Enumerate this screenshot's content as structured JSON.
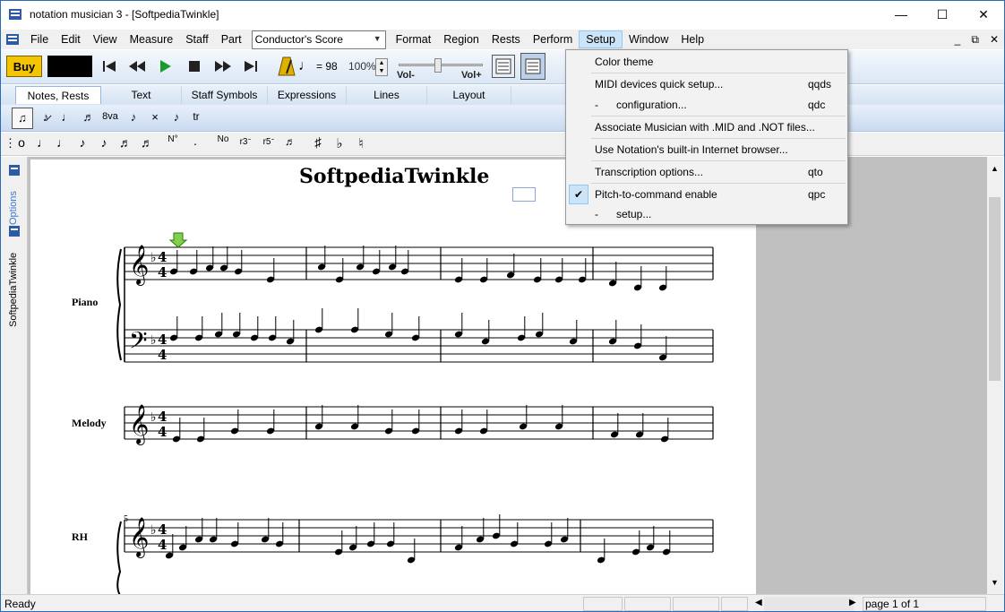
{
  "window": {
    "title": "notation musician 3 - [SoftpediaTwinkle]",
    "minimize": "—",
    "maximize": "☐",
    "close": "✕"
  },
  "menubar": {
    "items": [
      "File",
      "Edit",
      "View",
      "Measure",
      "Staff",
      "Part"
    ],
    "part_combo": "Conductor's Score",
    "items2": [
      "Format",
      "Region",
      "Rests",
      "Perform",
      "Setup",
      "Window",
      "Help"
    ],
    "mdi": {
      "minimize": "_",
      "restore": "⧉",
      "close": "✕"
    }
  },
  "toolbar": {
    "buy_label": "Buy",
    "tempo": "= 98",
    "zoom": "100%",
    "vol_minus": "Vol-",
    "vol_plus": "Vol+"
  },
  "palette_tabs": [
    "Notes, Rests",
    "Text",
    "Staff Symbols",
    "Expressions",
    "Lines",
    "Layout"
  ],
  "palette1_glyphs": [
    "♫",
    "♪̷",
    "♩",
    "♬",
    "8va",
    "♪",
    "×",
    "♪",
    "tr"
  ],
  "palette2_glyphs": [
    "·",
    "𝅝",
    "𝅗𝅥",
    "♩",
    "♪",
    "♬",
    "♬",
    "♬",
    "N",
    "·",
    "N",
    "r3",
    "r5",
    "r6",
    "♯",
    "♭",
    "♮"
  ],
  "sidebar": {
    "options_label": "Options",
    "doc_label": "SoftpediaTwinkle"
  },
  "score": {
    "title": "SoftpediaTwinkle",
    "staff_labels": {
      "piano": "Piano",
      "melody": "Melody",
      "rh": "RH"
    },
    "measure_number": "5",
    "time_sig_top": "4",
    "time_sig_bottom": "4"
  },
  "setup_menu": {
    "items": [
      {
        "label": "Color theme",
        "shortcut": ""
      },
      {
        "label": "MIDI devices quick setup...",
        "shortcut": "qqds"
      },
      {
        "label": "-      configuration...",
        "shortcut": "qdc"
      },
      {
        "label": "Associate Musician with .MID and .NOT files...",
        "shortcut": ""
      },
      {
        "label": "Use Notation's built-in Internet browser...",
        "shortcut": ""
      },
      {
        "label": "Transcription options...",
        "shortcut": "qto"
      },
      {
        "label": "Pitch-to-command enable",
        "shortcut": "qpc",
        "checked": true
      },
      {
        "label": "-      setup...",
        "shortcut": ""
      }
    ]
  },
  "status": {
    "ready": "Ready",
    "page": "page 1 of 1"
  },
  "colors": {
    "accent": "#cce4f7",
    "buy": "#f5c400",
    "play": "#1a9c2c",
    "doc_bg": "#c0c0c0"
  }
}
